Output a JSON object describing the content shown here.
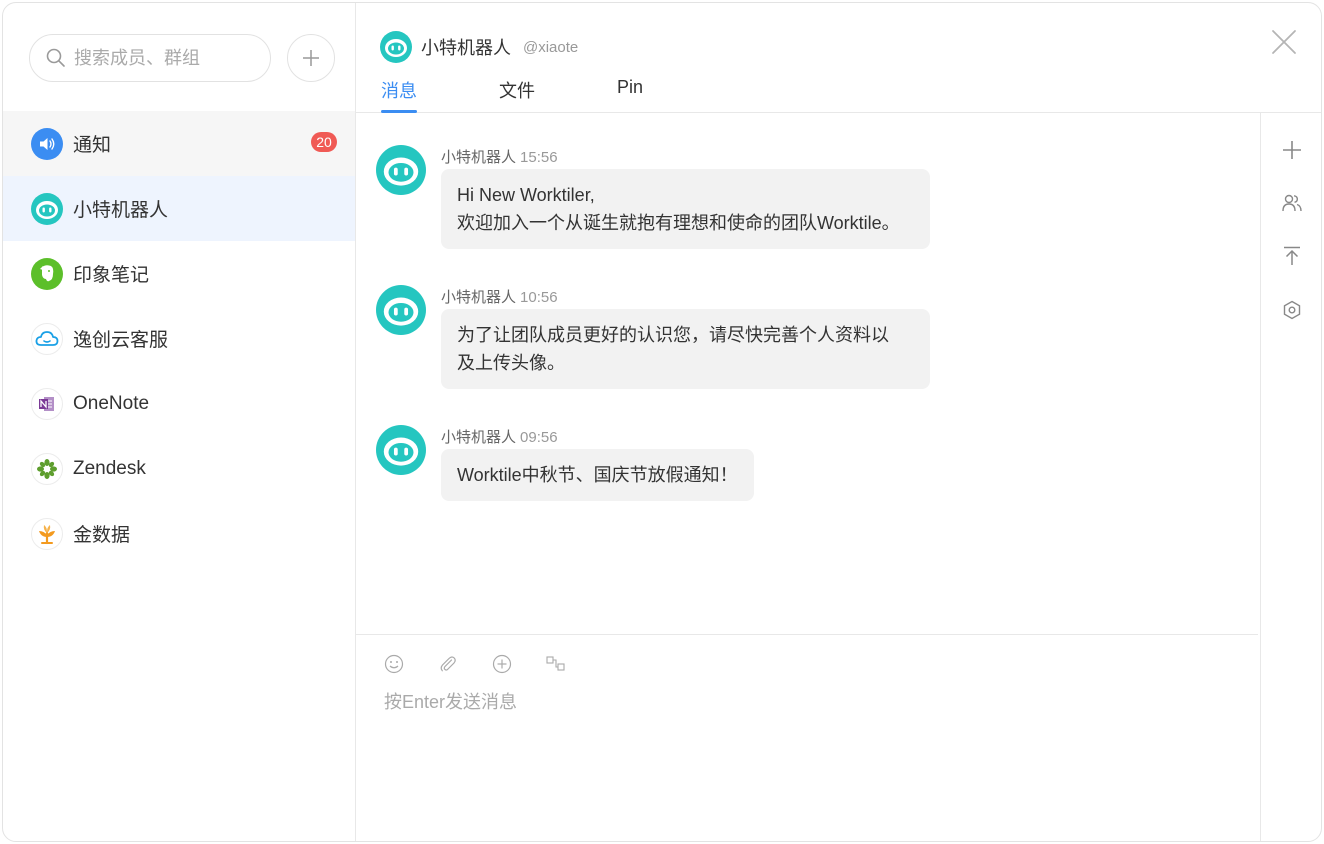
{
  "sidebar": {
    "search": {
      "placeholder": "搜索成员、群组"
    },
    "conversations": [
      {
        "label": "通知",
        "icon": "speaker-icon",
        "badge": "20"
      },
      {
        "label": "小特机器人",
        "icon": "robot-icon"
      },
      {
        "label": "印象笔记",
        "icon": "evernote-icon"
      },
      {
        "label": "逸创云客服",
        "icon": "cloud-icon"
      },
      {
        "label": "OneNote",
        "icon": "onenote-icon"
      },
      {
        "label": "Zendesk",
        "icon": "zendesk-icon"
      },
      {
        "label": "金数据",
        "icon": "jinshuju-icon"
      }
    ]
  },
  "header": {
    "name": "小特机器人",
    "handle": "@xiaote",
    "tabs": [
      {
        "label": "消息"
      },
      {
        "label": "文件"
      },
      {
        "label": "Pin"
      }
    ]
  },
  "messages": [
    {
      "sender": "小特机器人",
      "time": "15:56",
      "lines": [
        "Hi New Worktiler,",
        "欢迎加入一个从诞生就抱有理想和使命的团队Worktile。"
      ]
    },
    {
      "sender": "小特机器人",
      "time": "10:56",
      "lines": [
        "为了让团队成员更好的认识您，请尽快完善个人资料以",
        "及上传头像。"
      ]
    },
    {
      "sender": "小特机器人",
      "time": "09:56",
      "lines": [
        "Worktile中秋节、国庆节放假通知！"
      ]
    }
  ],
  "composer": {
    "placeholder": "按Enter发送消息"
  },
  "colors": {
    "accent": "#3b8df2",
    "badge": "#f05a55",
    "robot": "#25c6c0",
    "evernote": "#5cbf2a",
    "onenote": "#7b3a96",
    "zendesk": "#5e9e2e",
    "jinshuju": "#f39a1f"
  }
}
